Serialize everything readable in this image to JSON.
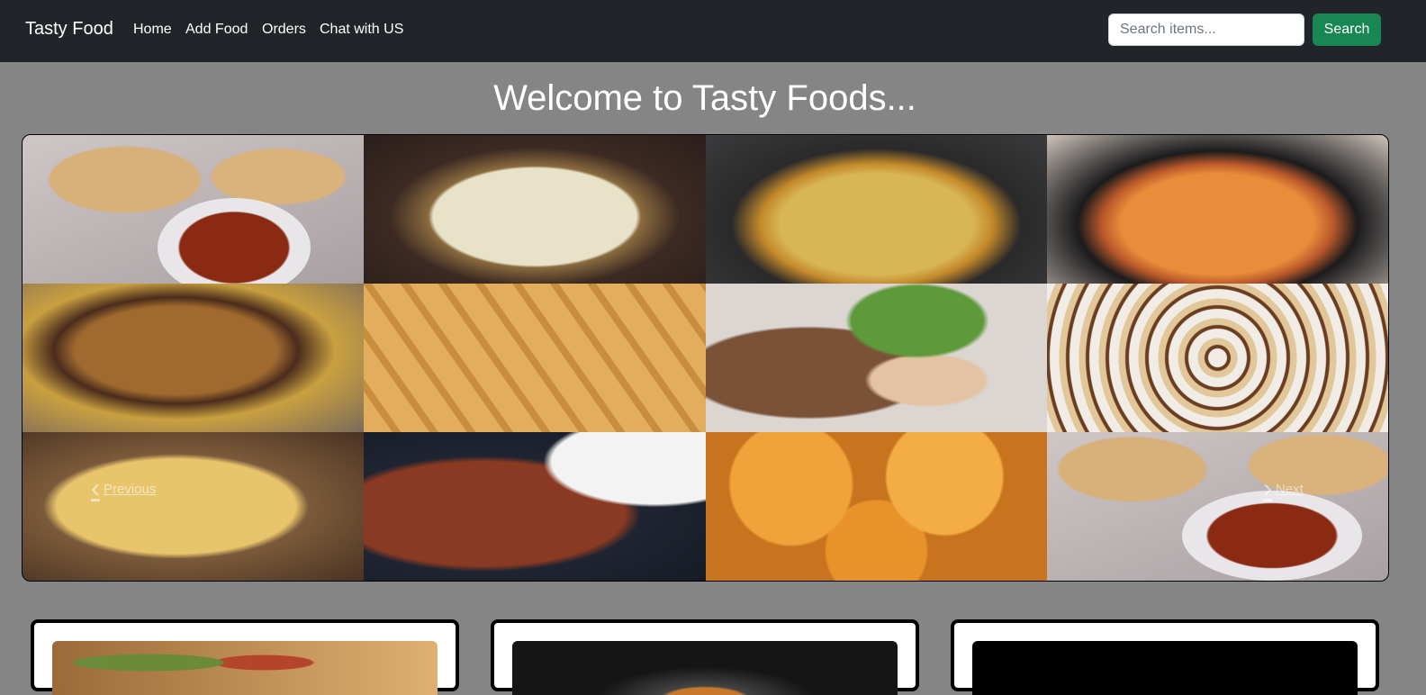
{
  "navbar": {
    "brand": "Tasty Food",
    "links": [
      "Home",
      "Add Food",
      "Orders",
      "Chat with US"
    ],
    "search_placeholder": "Search items...",
    "search_button": "Search"
  },
  "page": {
    "heading": "Welcome to Tasty Foods..."
  },
  "carousel": {
    "prev_label": "Previous",
    "next_label": "Next",
    "tiles": [
      "chole-bhature",
      "rabri",
      "biryani",
      "paneer-curry",
      "dal-makhani",
      "samosa",
      "grilled-kebab",
      "papdi-chaat",
      "garlic-naan",
      "mutton-curry",
      "fried-snack",
      "chole-bhature"
    ]
  },
  "colors": {
    "navbar": "#212529",
    "background": "#858585",
    "search_button": "#198754"
  }
}
